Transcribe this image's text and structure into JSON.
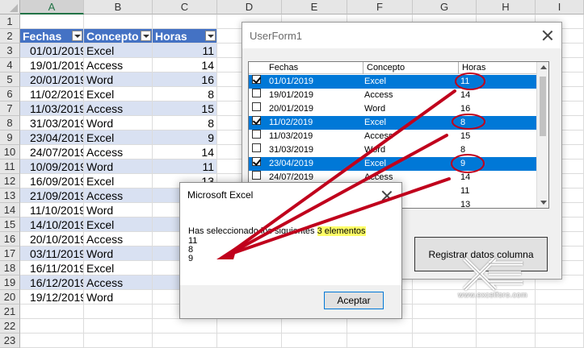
{
  "spreadsheet": {
    "columns": [
      "A",
      "B",
      "C",
      "D",
      "E",
      "F",
      "G",
      "H",
      "I"
    ],
    "rows": [
      "1",
      "2",
      "3",
      "4",
      "5",
      "6",
      "7",
      "8",
      "9",
      "10",
      "11",
      "12",
      "13",
      "14",
      "15",
      "16",
      "17",
      "18",
      "19",
      "20",
      "21",
      "22",
      "23"
    ],
    "table": {
      "headers": [
        "Fechas",
        "Concepto",
        "Horas"
      ],
      "records": [
        [
          "01/01/2019",
          "Excel",
          "11"
        ],
        [
          "19/01/2019",
          "Access",
          "14"
        ],
        [
          "20/01/2019",
          "Word",
          "16"
        ],
        [
          "11/02/2019",
          "Excel",
          "8"
        ],
        [
          "11/03/2019",
          "Access",
          "15"
        ],
        [
          "31/03/2019",
          "Word",
          "8"
        ],
        [
          "23/04/2019",
          "Excel",
          "9"
        ],
        [
          "24/07/2019",
          "Access",
          "14"
        ],
        [
          "10/09/2019",
          "Word",
          "11"
        ],
        [
          "16/09/2019",
          "Excel",
          "13"
        ],
        [
          "21/09/2019",
          "Access",
          "9"
        ],
        [
          "11/10/2019",
          "Word",
          ""
        ],
        [
          "14/10/2019",
          "Excel",
          ""
        ],
        [
          "20/10/2019",
          "Access",
          ""
        ],
        [
          "03/11/2019",
          "Word",
          ""
        ],
        [
          "16/11/2019",
          "Excel",
          ""
        ],
        [
          "16/12/2019",
          "Access",
          ""
        ],
        [
          "19/12/2019",
          "Word",
          ""
        ]
      ]
    }
  },
  "userform": {
    "title": "UserForm1",
    "listbox": {
      "headers": [
        "Fechas",
        "Concepto",
        "Horas"
      ],
      "rows": [
        {
          "date": "01/01/2019",
          "concept": "Excel",
          "hours": "11",
          "checked": true
        },
        {
          "date": "19/01/2019",
          "concept": "Access",
          "hours": "14",
          "checked": false
        },
        {
          "date": "20/01/2019",
          "concept": "Word",
          "hours": "16",
          "checked": false
        },
        {
          "date": "11/02/2019",
          "concept": "Excel",
          "hours": "8",
          "checked": true
        },
        {
          "date": "11/03/2019",
          "concept": "Access",
          "hours": "15",
          "checked": false
        },
        {
          "date": "31/03/2019",
          "concept": "Word",
          "hours": "8",
          "checked": false
        },
        {
          "date": "23/04/2019",
          "concept": "Excel",
          "hours": "9",
          "checked": true
        },
        {
          "date": "24/07/2019",
          "concept": "Access",
          "hours": "14",
          "checked": false
        },
        {
          "date": "",
          "concept": "",
          "hours": "11",
          "checked": false
        },
        {
          "date": "",
          "concept": "",
          "hours": "13",
          "checked": false
        }
      ]
    },
    "register_button": "Registrar datos columna"
  },
  "msgbox": {
    "title": "Microsoft Excel",
    "message_prefix": "Has seleccionado los siguientes ",
    "message_highlight": "3 elementos",
    "values": [
      "11",
      "8",
      "9"
    ],
    "ok_button": "Aceptar"
  },
  "watermark": {
    "text": "www.excelforo.com"
  },
  "colors": {
    "table_header": "#4472c4",
    "table_band": "#d9e1f2",
    "selection": "#0078d7",
    "annotation": "#c0001c",
    "highlight": "#ffff66"
  }
}
